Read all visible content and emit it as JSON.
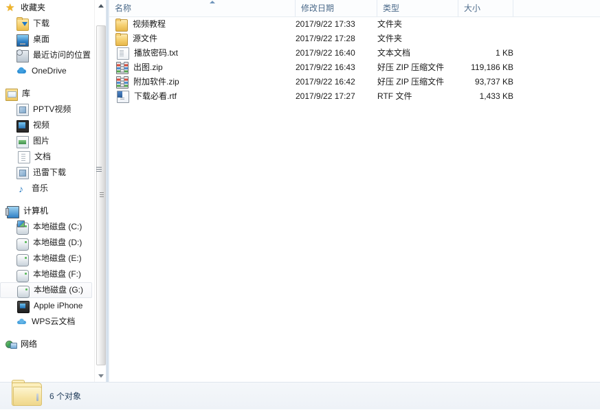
{
  "nav": {
    "groups": [
      {
        "name": "favorites",
        "root": {
          "label": "收藏夹",
          "icon": "star-icon"
        },
        "items": [
          {
            "label": "下载",
            "icon": "download-folder-icon"
          },
          {
            "label": "桌面",
            "icon": "desktop-icon"
          },
          {
            "label": "最近访问的位置",
            "icon": "recent-places-icon"
          },
          {
            "label": "OneDrive",
            "icon": "onedrive-cloud-icon"
          }
        ]
      },
      {
        "name": "libraries",
        "root": {
          "label": "库",
          "icon": "library-icon"
        },
        "items": [
          {
            "label": "PPTV视频",
            "icon": "pptv-video-icon"
          },
          {
            "label": "视频",
            "icon": "video-film-icon"
          },
          {
            "label": "图片",
            "icon": "pictures-icon"
          },
          {
            "label": "文档",
            "icon": "documents-icon"
          },
          {
            "label": "迅雷下载",
            "icon": "thunder-download-icon"
          },
          {
            "label": "音乐",
            "icon": "music-note-icon"
          }
        ]
      },
      {
        "name": "computer",
        "root": {
          "label": "计算机",
          "icon": "computer-icon"
        },
        "items": [
          {
            "label": "本地磁盘 (C:)",
            "icon": "system-drive-icon",
            "selected": false
          },
          {
            "label": "本地磁盘 (D:)",
            "icon": "drive-icon",
            "selected": false
          },
          {
            "label": "本地磁盘 (E:)",
            "icon": "drive-icon",
            "selected": false
          },
          {
            "label": "本地磁盘 (F:)",
            "icon": "drive-icon",
            "selected": false
          },
          {
            "label": "本地磁盘 (G:)",
            "icon": "drive-icon",
            "selected": true
          },
          {
            "label": "Apple iPhone",
            "icon": "iphone-icon",
            "selected": false
          },
          {
            "label": "WPS云文档",
            "icon": "wps-cloud-icon",
            "selected": false
          }
        ]
      },
      {
        "name": "network",
        "root": {
          "label": "网络",
          "icon": "network-icon"
        },
        "items": []
      }
    ]
  },
  "columns": [
    {
      "key": "name",
      "label": "名称",
      "sorted": "asc"
    },
    {
      "key": "date",
      "label": "修改日期",
      "sorted": ""
    },
    {
      "key": "type",
      "label": "类型",
      "sorted": ""
    },
    {
      "key": "size",
      "label": "大小",
      "sorted": ""
    }
  ],
  "files": [
    {
      "name": "视频教程",
      "icon": "folder-icon",
      "date": "2017/9/22 17:33",
      "type": "文件夹",
      "size": ""
    },
    {
      "name": "源文件",
      "icon": "folder-icon",
      "date": "2017/9/22 17:28",
      "type": "文件夹",
      "size": ""
    },
    {
      "name": "播放密码.txt",
      "icon": "text-file-icon",
      "date": "2017/9/22 16:40",
      "type": "文本文档",
      "size": "1 KB"
    },
    {
      "name": "出图.zip",
      "icon": "zip-file-icon",
      "date": "2017/9/22 16:43",
      "type": "好压 ZIP 压缩文件",
      "size": "119,186 KB"
    },
    {
      "name": "附加软件.zip",
      "icon": "zip-file-icon",
      "date": "2017/9/22 16:42",
      "type": "好压 ZIP 压缩文件",
      "size": "93,737 KB"
    },
    {
      "name": "下载必看.rtf",
      "icon": "rtf-file-icon",
      "date": "2017/9/22 17:27",
      "type": "RTF 文件",
      "size": "1,433 KB"
    }
  ],
  "status": {
    "item_count_label": "6 个对象",
    "folder_icon": "large-folder-icon"
  },
  "colors": {
    "header_text": "#4b6a8a",
    "body_text": "#1a1a1a",
    "status_text": "#26415e",
    "folder_yellow": "#f7d275",
    "selection_border": "#e2e6ec"
  }
}
